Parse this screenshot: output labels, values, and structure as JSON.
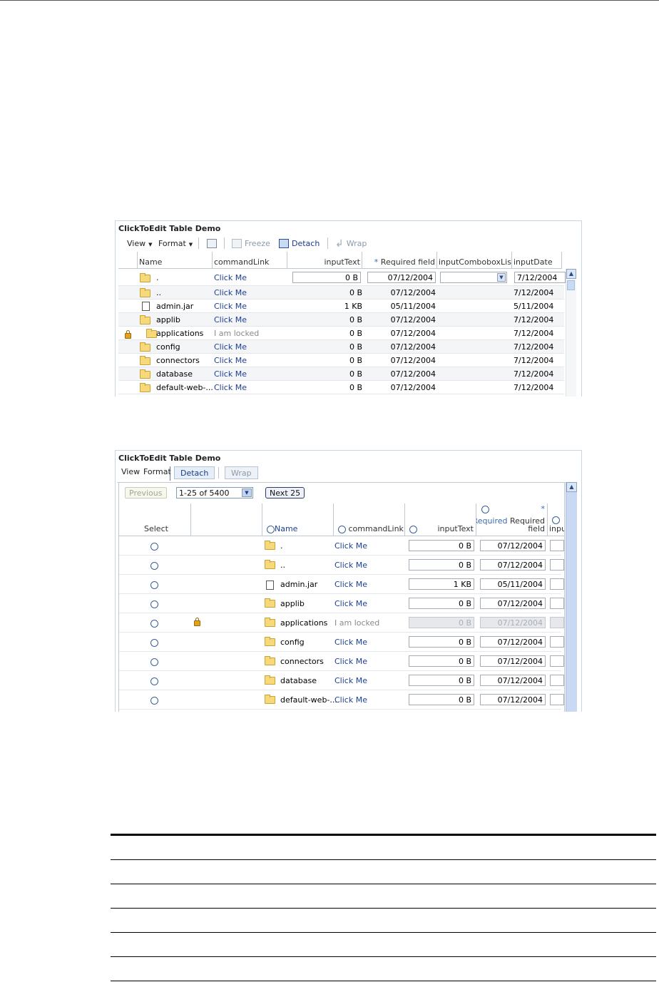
{
  "panel1": {
    "title": "ClickToEdit Table Demo",
    "toolbar": {
      "view": "View",
      "format": "Format",
      "freeze": "Freeze",
      "detach": "Detach",
      "wrap": "Wrap"
    },
    "columns": {
      "name": "Name",
      "commandLink": "commandLink",
      "inputText": "inputText",
      "required_star": "*",
      "required": "Required field",
      "combo": "inputComboboxListOf",
      "date": "inputDate"
    },
    "rows": [
      {
        "name": ".",
        "link": "Click Me",
        "size": "0 B",
        "req": "07/12/2004",
        "date": "7/12/2004",
        "icon": "folder",
        "locked": false
      },
      {
        "name": "..",
        "link": "Click Me",
        "size": "0 B",
        "req": "07/12/2004",
        "date": "7/12/2004",
        "icon": "folder",
        "locked": false
      },
      {
        "name": "admin.jar",
        "link": "Click Me",
        "size": "1 KB",
        "req": "05/11/2004",
        "date": "5/11/2004",
        "icon": "file",
        "locked": false
      },
      {
        "name": "applib",
        "link": "Click Me",
        "size": "0 B",
        "req": "07/12/2004",
        "date": "7/12/2004",
        "icon": "folder",
        "locked": false
      },
      {
        "name": "applications",
        "link": "I am locked",
        "size": "0 B",
        "req": "07/12/2004",
        "date": "7/12/2004",
        "icon": "folder",
        "locked": true
      },
      {
        "name": "config",
        "link": "Click Me",
        "size": "0 B",
        "req": "07/12/2004",
        "date": "7/12/2004",
        "icon": "folder",
        "locked": false
      },
      {
        "name": "connectors",
        "link": "Click Me",
        "size": "0 B",
        "req": "07/12/2004",
        "date": "7/12/2004",
        "icon": "folder",
        "locked": false
      },
      {
        "name": "database",
        "link": "Click Me",
        "size": "0 B",
        "req": "07/12/2004",
        "date": "7/12/2004",
        "icon": "folder",
        "locked": false
      },
      {
        "name": "default-web-...",
        "link": "Click Me",
        "size": "0 B",
        "req": "07/12/2004",
        "date": "7/12/2004",
        "icon": "folder",
        "locked": false
      }
    ]
  },
  "panel2": {
    "title": "ClickToEdit Table Demo",
    "toolbar": {
      "view": "View",
      "format": "Format",
      "detach": "Detach",
      "wrap": "Wrap"
    },
    "nav": {
      "previous": "Previous",
      "range": "1-25 of 5400",
      "next": "Next 25"
    },
    "columns": {
      "select": "Select",
      "name": "Name",
      "commandLink": "commandLink",
      "inputText": "inputText",
      "required_star": "*",
      "required_a": "Required",
      "required_b": "Required",
      "required_c": "field",
      "next_partial": "inpu"
    },
    "rows": [
      {
        "name": ".",
        "link": "Click Me",
        "size": "0 B",
        "req": "07/12/2004",
        "icon": "folder",
        "locked": false
      },
      {
        "name": "..",
        "link": "Click Me",
        "size": "0 B",
        "req": "07/12/2004",
        "icon": "folder",
        "locked": false
      },
      {
        "name": "admin.jar",
        "link": "Click Me",
        "size": "1 KB",
        "req": "05/11/2004",
        "icon": "file",
        "locked": false
      },
      {
        "name": "applib",
        "link": "Click Me",
        "size": "0 B",
        "req": "07/12/2004",
        "icon": "folder",
        "locked": false
      },
      {
        "name": "applications",
        "link": "I am locked",
        "size": "0 B",
        "req": "07/12/2004",
        "icon": "folder",
        "locked": true
      },
      {
        "name": "config",
        "link": "Click Me",
        "size": "0 B",
        "req": "07/12/2004",
        "icon": "folder",
        "locked": false
      },
      {
        "name": "connectors",
        "link": "Click Me",
        "size": "0 B",
        "req": "07/12/2004",
        "icon": "folder",
        "locked": false
      },
      {
        "name": "database",
        "link": "Click Me",
        "size": "0 B",
        "req": "07/12/2004",
        "icon": "folder",
        "locked": false
      },
      {
        "name": "default-web-...",
        "link": "Click Me",
        "size": "0 B",
        "req": "07/12/2004",
        "icon": "folder",
        "locked": false
      }
    ]
  },
  "colors": {
    "link": "#1c3f94",
    "locked": "#8a8a8a",
    "border": "#c8d6e2",
    "scroll": "#c9d9f3"
  }
}
